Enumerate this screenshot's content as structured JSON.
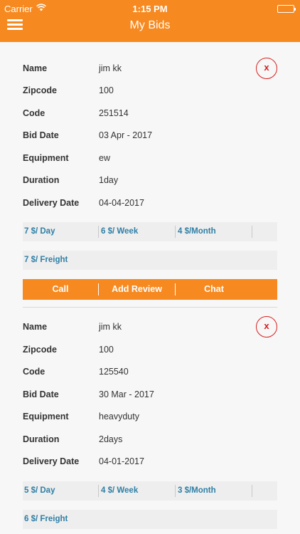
{
  "status_bar": {
    "carrier": "Carrier",
    "time": "1:15 PM"
  },
  "header": {
    "title": "My Bids"
  },
  "labels": {
    "name": "Name",
    "zipcode": "Zipcode",
    "code": "Code",
    "bid_date": "Bid Date",
    "equipment": "Equipment",
    "duration": "Duration",
    "delivery_date": "Delivery Date"
  },
  "close_label": "x",
  "actions": {
    "call": "Call",
    "add_review": "Add Review",
    "chat": "Chat"
  },
  "bids": [
    {
      "name": "jim kk",
      "zipcode": "100",
      "code": "251514",
      "bid_date": "03 Apr - 2017",
      "equipment": "ew",
      "duration": "1day",
      "delivery_date": "04-04-2017",
      "rate_day": "7 $/ Day",
      "rate_week": "6 $/ Week",
      "rate_month": "4 $/Month",
      "freight": "7 $/ Freight"
    },
    {
      "name": "jim kk",
      "zipcode": "100",
      "code": "125540",
      "bid_date": "30 Mar - 2017",
      "equipment": "heavyduty",
      "duration": "2days",
      "delivery_date": "04-01-2017",
      "rate_day": "5 $/ Day",
      "rate_week": "4 $/ Week",
      "rate_month": "3 $/Month",
      "freight": "6 $/ Freight"
    }
  ],
  "colors": {
    "brand": "#f6891f",
    "rate_text": "#2f7fa5",
    "close": "#d61f1f"
  }
}
